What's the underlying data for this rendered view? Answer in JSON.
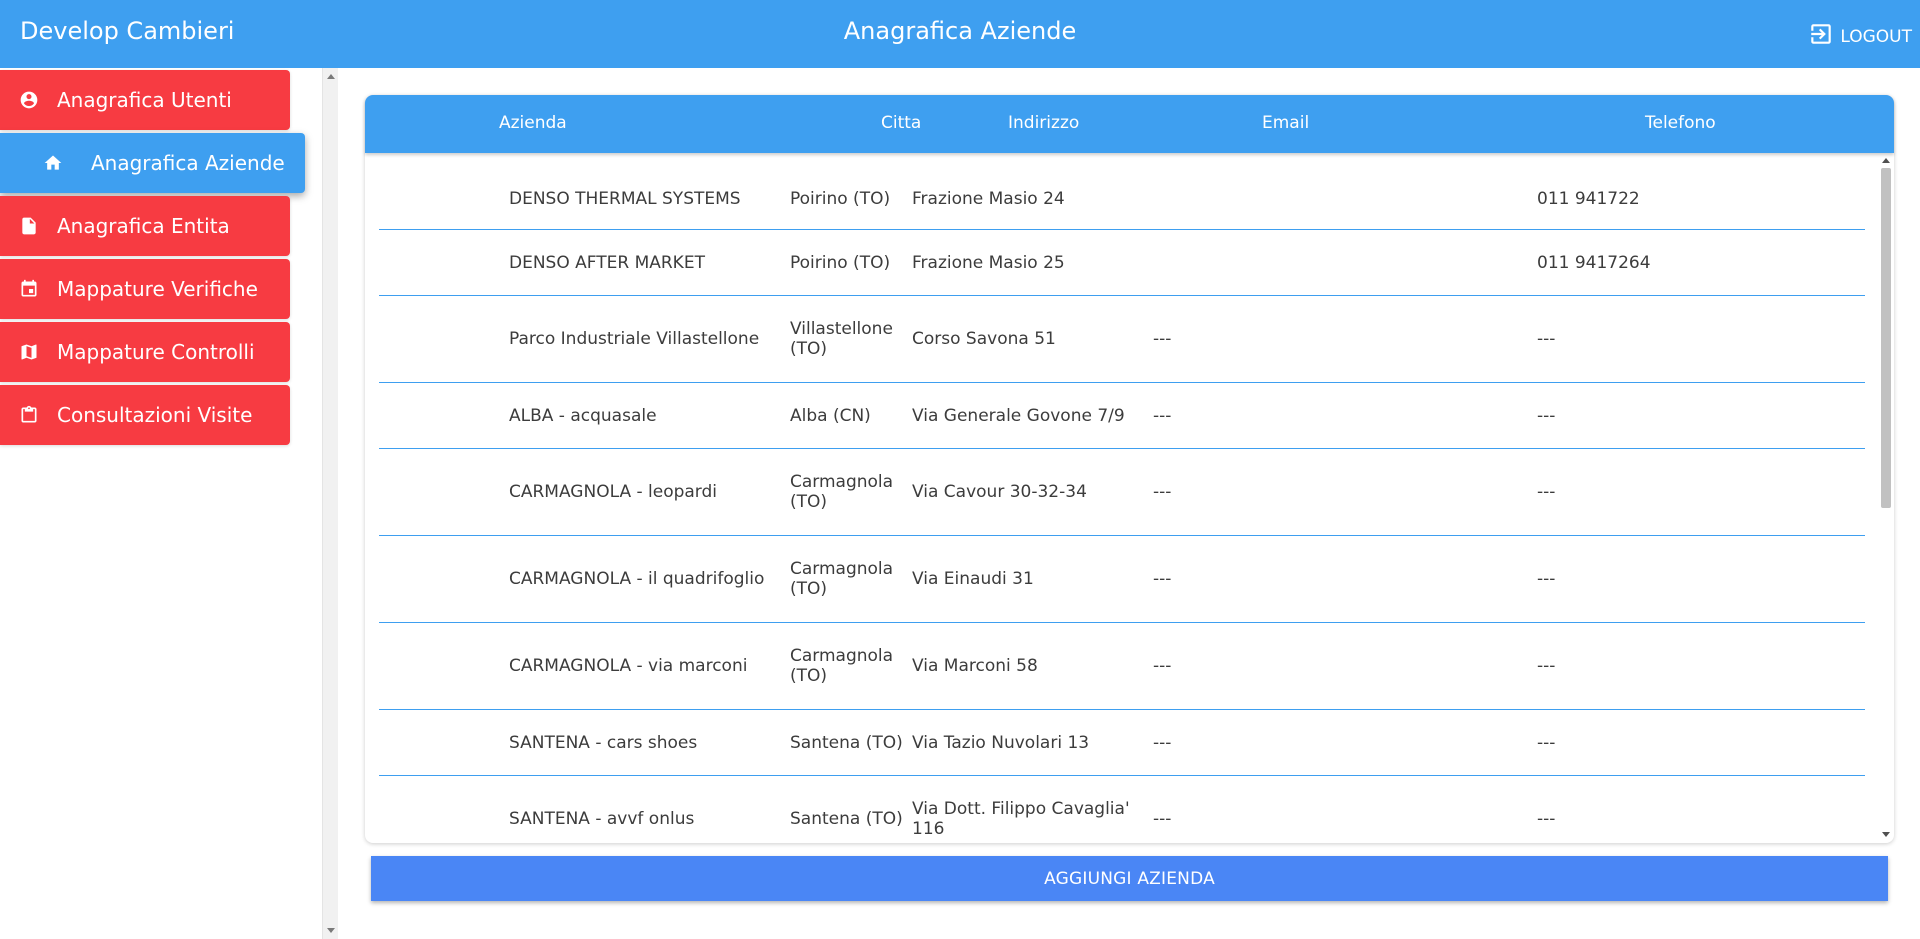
{
  "header": {
    "app_title": "Develop Cambieri",
    "page_title": "Anagrafica Aziende",
    "logout_label": "LOGOUT",
    "color": "#3e9ff0"
  },
  "sidebar": {
    "items": [
      {
        "label": "Anagrafica Utenti",
        "icon": "account-circle-icon",
        "active": false
      },
      {
        "label": "Anagrafica Aziende",
        "icon": "home-icon",
        "active": true
      },
      {
        "label": "Anagrafica Entita",
        "icon": "document-icon",
        "active": false
      },
      {
        "label": "Mappature Verifiche",
        "icon": "calendar-icon",
        "active": false
      },
      {
        "label": "Mappature Controlli",
        "icon": "map-icon",
        "active": false
      },
      {
        "label": "Consultazioni Visite",
        "icon": "clipboard-icon",
        "active": false
      }
    ],
    "inactive_color": "#f73b42",
    "active_color": "#3e9ff0"
  },
  "table": {
    "headers": {
      "azienda": "Azienda",
      "citta": "Citta",
      "indirizzo": "Indirizzo",
      "email": "Email",
      "telefono": "Telefono"
    },
    "rows": [
      {
        "azienda": "DENSO THERMAL SYSTEMS",
        "citta": "Poirino (TO)",
        "indirizzo": "Frazione Masio 24",
        "email": "",
        "telefono": "011 941722"
      },
      {
        "azienda": "DENSO AFTER MARKET",
        "citta": "Poirino (TO)",
        "indirizzo": "Frazione Masio 25",
        "email": "",
        "telefono": "011 9417264"
      },
      {
        "azienda": "Parco Industriale Villastellone",
        "citta": "Villastellone (TO)",
        "indirizzo": "Corso Savona 51",
        "email": "---",
        "telefono": "---"
      },
      {
        "azienda": "ALBA - acquasale",
        "citta": "Alba (CN)",
        "indirizzo": "Via Generale Govone 7/9",
        "email": "---",
        "telefono": "---"
      },
      {
        "azienda": "CARMAGNOLA - leopardi",
        "citta": "Carmagnola (TO)",
        "indirizzo": "Via Cavour 30-32-34",
        "email": "---",
        "telefono": "---"
      },
      {
        "azienda": "CARMAGNOLA - il quadrifoglio",
        "citta": "Carmagnola (TO)",
        "indirizzo": "Via Einaudi 31",
        "email": "---",
        "telefono": "---"
      },
      {
        "azienda": "CARMAGNOLA - via marconi",
        "citta": "Carmagnola (TO)",
        "indirizzo": "Via Marconi 58",
        "email": "---",
        "telefono": "---"
      },
      {
        "azienda": "SANTENA - cars shoes",
        "citta": "Santena (TO)",
        "indirizzo": "Via Tazio Nuvolari 13",
        "email": "---",
        "telefono": "---"
      },
      {
        "azienda": "SANTENA - avvf onlus",
        "citta": "Santena (TO)",
        "indirizzo": "Via Dott. Filippo Cavaglia' 116",
        "email": "---",
        "telefono": "---"
      }
    ]
  },
  "add_button": {
    "label": "AGGIUNGI AZIENDA",
    "color": "#4a86f5"
  }
}
